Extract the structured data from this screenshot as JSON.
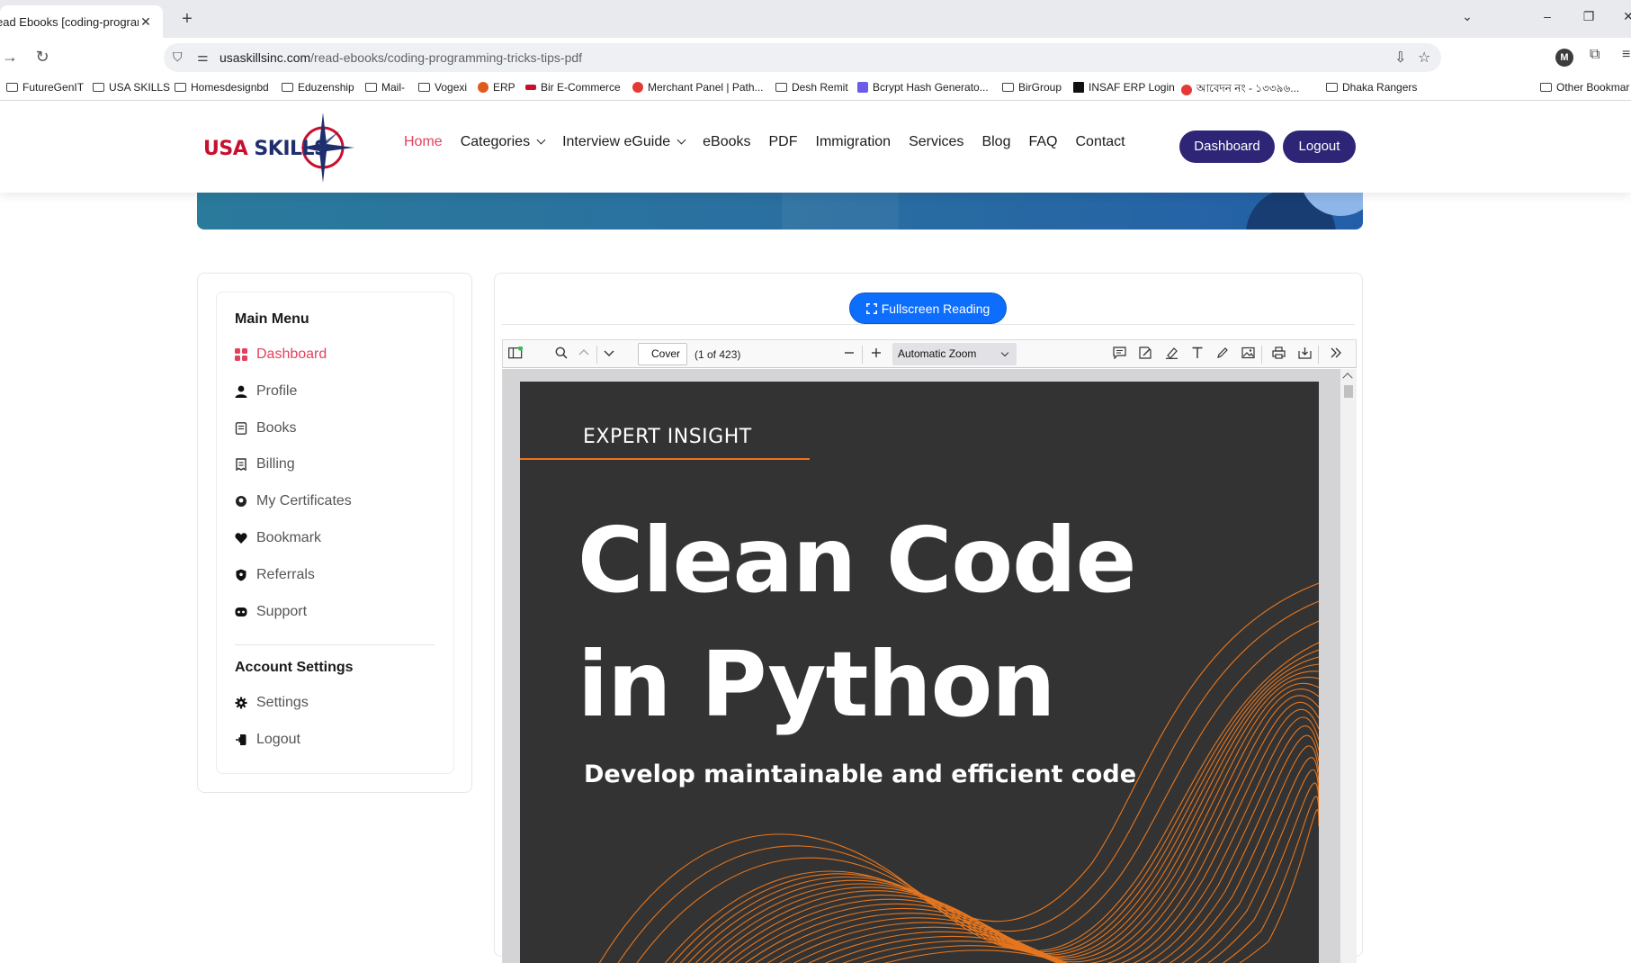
{
  "browser": {
    "tab_title": "ead Ebooks [coding-programm",
    "tab_close": "✕",
    "new_tab": "+",
    "url_host": "usaskillsinc.com",
    "url_path": "/read-ebooks/coding-programming-tricks-tips-pdf",
    "profile_initial": "M",
    "bookmarks": [
      "FutureGenIT",
      "USA SKILLS",
      "Homesdesignbd",
      "Eduzenship",
      "Mail-",
      "Vogexi",
      "ERP",
      "Bir E-Commerce",
      "Merchant Panel | Path...",
      "Desh Remit",
      "Bcrypt Hash Generato...",
      "BirGroup",
      "INSAF ERP Login",
      "আবেদন নং - ১৩৩৯৬...",
      "Dhaka Rangers",
      "Other Bookmar"
    ]
  },
  "site": {
    "logo": {
      "usa": "USA",
      "skills": "SKILLS"
    },
    "nav": [
      {
        "label": "Home",
        "active": true
      },
      {
        "label": "Categories",
        "dropdown": true
      },
      {
        "label": "Interview eGuide",
        "dropdown": true
      },
      {
        "label": "eBooks"
      },
      {
        "label": "PDF"
      },
      {
        "label": "Immigration"
      },
      {
        "label": "Services"
      },
      {
        "label": "Blog"
      },
      {
        "label": "FAQ"
      },
      {
        "label": "Contact"
      }
    ],
    "dashboard_btn": "Dashboard",
    "logout_btn": "Logout",
    "colors": {
      "accent": "#e4405f",
      "brand_purple": "#2f2577",
      "primary_blue": "#0d6efd"
    }
  },
  "sidebar": {
    "main_heading": "Main Menu",
    "main_items": [
      {
        "label": "Dashboard",
        "icon": "dashboard-icon",
        "active": true
      },
      {
        "label": "Profile",
        "icon": "user-icon"
      },
      {
        "label": "Books",
        "icon": "book-icon"
      },
      {
        "label": "Billing",
        "icon": "receipt-icon"
      },
      {
        "label": "My Certificates",
        "icon": "certificate-icon"
      },
      {
        "label": "Bookmark",
        "icon": "heart-icon"
      },
      {
        "label": "Referrals",
        "icon": "referral-icon"
      },
      {
        "label": "Support",
        "icon": "support-icon"
      }
    ],
    "account_heading": "Account Settings",
    "account_items": [
      {
        "label": "Settings",
        "icon": "gear-icon"
      },
      {
        "label": "Logout",
        "icon": "logout-icon"
      }
    ]
  },
  "reader": {
    "fullscreen_label": "Fullscreen Reading",
    "page_value": "Cover",
    "page_of": "(1 of 423)",
    "zoom": "Automatic Zoom"
  },
  "book": {
    "series": "EXPERT INSIGHT",
    "title_line1": "Clean Code",
    "title_line2": "in Python",
    "subtitle": "Develop maintainable and efficient code"
  }
}
